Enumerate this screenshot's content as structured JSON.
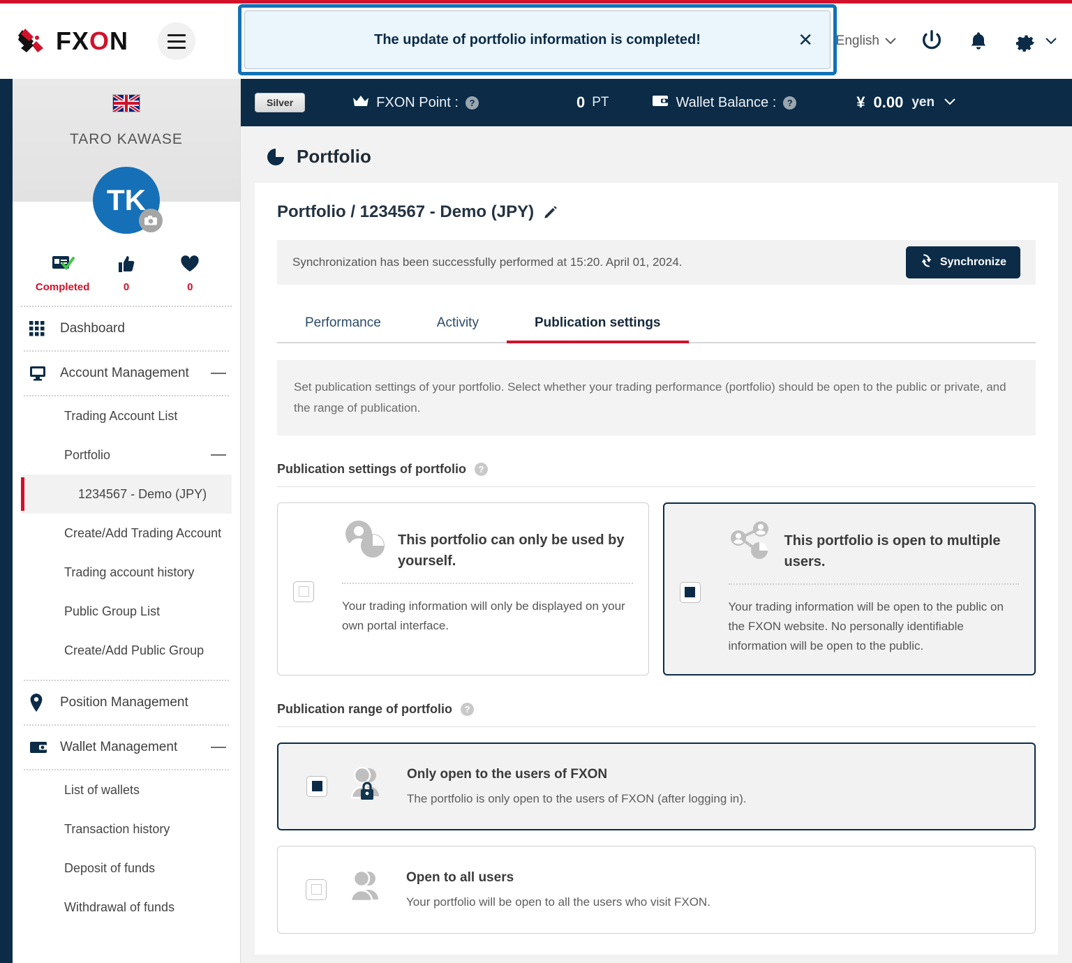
{
  "brand": {
    "name": "FXON"
  },
  "header": {
    "menu_icon": "hamburger-icon",
    "language": "English",
    "power_icon": "power-icon",
    "bell_icon": "bell-icon",
    "gear_icon": "gear-icon"
  },
  "notification": {
    "message": "The update of portfolio information is completed!",
    "close_label": "✕",
    "border_color": "#1272b5",
    "background_color": "#eaf5fc"
  },
  "subbar": {
    "rank_badge": "Silver",
    "point_icon": "crown-icon",
    "point_label": "FXON Point :",
    "point_value": "0",
    "point_unit": "PT",
    "wallet_icon": "wallet-icon",
    "wallet_label": "Wallet Balance :",
    "wallet_symbol": "¥",
    "wallet_value": "0.00",
    "wallet_unit": "yen",
    "help_glyph": "?"
  },
  "sidebar": {
    "flag": "uk-flag",
    "user_name": "TARO KAWASE",
    "avatar_initials": "TK",
    "stats": [
      {
        "icon": "id-verified-icon",
        "label": "Completed"
      },
      {
        "icon": "thumbs-up-icon",
        "label": "0"
      },
      {
        "icon": "heart-icon",
        "label": "0"
      }
    ],
    "nav": [
      {
        "icon": "grid-icon",
        "label": "Dashboard",
        "collapsible": false
      },
      {
        "icon": "monitor-icon",
        "label": "Account Management",
        "collapsible": true
      }
    ],
    "account_children": [
      {
        "label": "Trading Account List",
        "active": false,
        "collapsible": false
      },
      {
        "label": "Portfolio",
        "active": false,
        "collapsible": true
      },
      {
        "label": "1234567 - Demo (JPY)",
        "active": true,
        "indent": true
      },
      {
        "label": "Create/Add Trading Account",
        "active": false
      },
      {
        "label": "Trading account history",
        "active": false
      },
      {
        "label": "Public Group List",
        "active": false
      },
      {
        "label": "Create/Add Public Group",
        "active": false
      }
    ],
    "position": {
      "icon": "map-pin-icon",
      "label": "Position Management"
    },
    "wallet": {
      "icon": "wallet-icon",
      "label": "Wallet Management"
    },
    "wallet_children": [
      {
        "label": "List of wallets"
      },
      {
        "label": "Transaction history"
      },
      {
        "label": "Deposit of funds"
      },
      {
        "label": "Withdrawal of funds"
      }
    ]
  },
  "main": {
    "page_icon": "pie-chart-icon",
    "page_title": "Portfolio",
    "breadcrumb": "Portfolio / 1234567 - Demo (JPY)",
    "edit_icon": "pencil-icon",
    "sync_message": "Synchronization has been successfully performed at 15:20. April 01, 2024.",
    "sync_button": "Synchronize",
    "sync_icon": "refresh-icon",
    "tabs": [
      {
        "label": "Performance",
        "active": false
      },
      {
        "label": "Activity",
        "active": false
      },
      {
        "label": "Publication settings",
        "active": true
      }
    ],
    "description": "Set publication settings of your portfolio. Select whether your trading performance (portfolio) should be open to the public or private, and the range of publication.",
    "settings_section": {
      "label": "Publication settings of portfolio",
      "help_glyph": "?",
      "options": [
        {
          "icon": "person-chart-icon",
          "title": "This portfolio can only be used by yourself.",
          "description": "Your trading information will only be displayed on your own portal interface.",
          "selected": false
        },
        {
          "icon": "share-network-chart-icon",
          "title": "This portfolio is open to multiple users.",
          "description": "Your trading information will be open to the public on the FXON website. No personally identifiable information will be open to the public.",
          "selected": true
        }
      ]
    },
    "range_section": {
      "label": "Publication range of portfolio",
      "help_glyph": "?",
      "options": [
        {
          "icon": "users-lock-icon",
          "title": "Only open to the users of FXON",
          "description": "The portfolio is only open to the users of FXON (after logging in).",
          "selected": true
        },
        {
          "icon": "users-icon",
          "title": "Open to all users",
          "description": "Your portfolio will be open to all the users who visit FXON.",
          "selected": false
        }
      ]
    }
  }
}
